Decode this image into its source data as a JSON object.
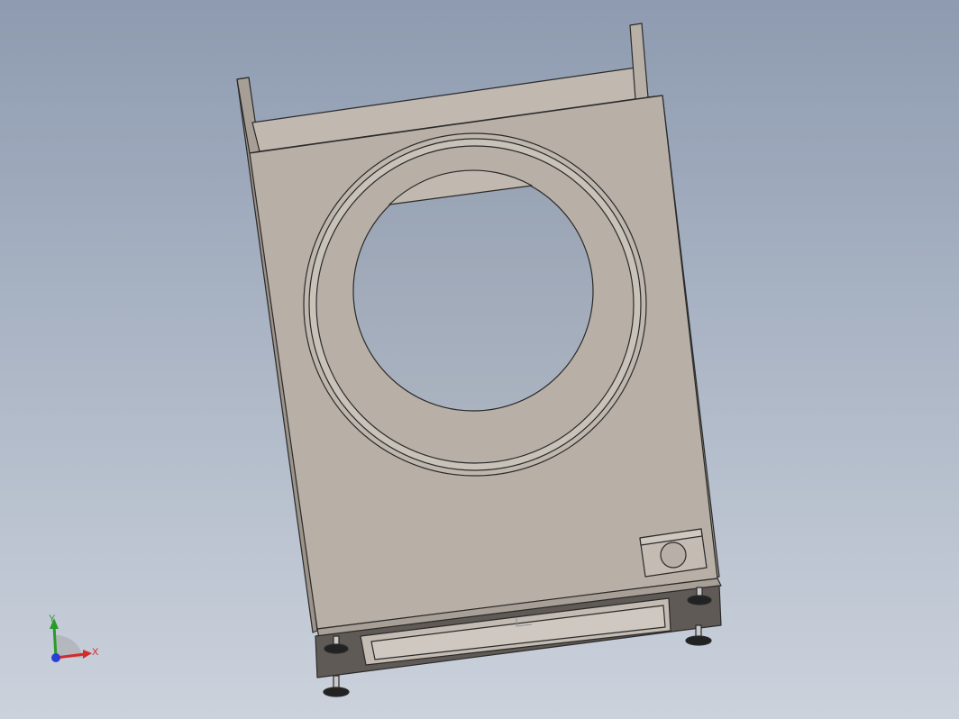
{
  "viewport": {
    "background_top": "#8e9bb0",
    "background_bottom": "#cbd2dc",
    "model": {
      "body_color": "#b5aca3",
      "edge_color": "#2a2a2a",
      "side_color": "#9c938a",
      "foot_color": "#222222",
      "opening_color": "#a4adbb"
    }
  },
  "triad": {
    "x_label": "X",
    "y_label": "Y",
    "x_color": "#d42a2a",
    "y_color": "#2a9a2a",
    "z_color": "#2a3fd4"
  }
}
